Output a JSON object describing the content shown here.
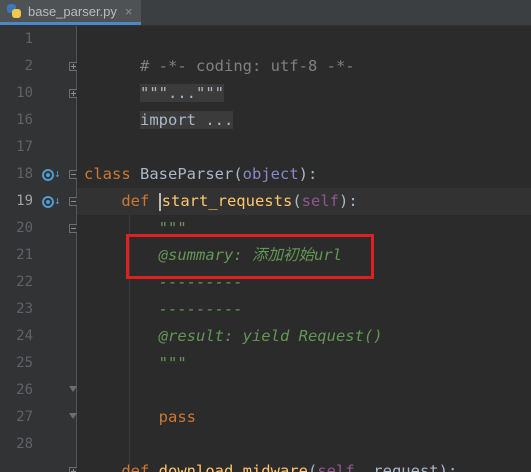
{
  "tab": {
    "filename": "base_parser.py",
    "close": "×"
  },
  "gutter": {
    "line_numbers": [
      "1",
      "2",
      "10",
      "16",
      "17",
      "18",
      "19",
      "20",
      "21",
      "22",
      "23",
      "24",
      "25",
      "26",
      "27",
      "28"
    ]
  },
  "code": {
    "line1": "# -*- coding: utf-8 -*-",
    "line2_fold": "\"\"\"...\"\"\"",
    "line10_fold": "import ...",
    "line18": {
      "kw": "class ",
      "name": "BaseParser",
      "open": "(",
      "base": "object",
      "close": "):"
    },
    "line19": {
      "indent": "    ",
      "kw": "def ",
      "name": "start_requests",
      "open": "(",
      "self": "self",
      "close": "):"
    },
    "line20": "        \"\"\"",
    "line21": {
      "indent": "        ",
      "tag": "@summary:",
      "text": " 添加初始url"
    },
    "line22": "        ---------",
    "line23": "        ---------",
    "line24": {
      "indent": "        ",
      "tag": "@result:",
      "text": " yield Request()"
    },
    "line25": "        \"\"\"",
    "line27": {
      "indent": "        ",
      "kw": "pass"
    },
    "line29": {
      "indent": "    ",
      "kw": "def ",
      "name": "download_midware",
      "open": "(",
      "self": "self",
      "rest": ", request):"
    }
  },
  "colors": {
    "background": "#2b2b2b",
    "gutter": "#313335",
    "keyword": "#cc7832",
    "function": "#ffc66d",
    "docstring": "#629755",
    "highlight_box": "#e02020"
  }
}
